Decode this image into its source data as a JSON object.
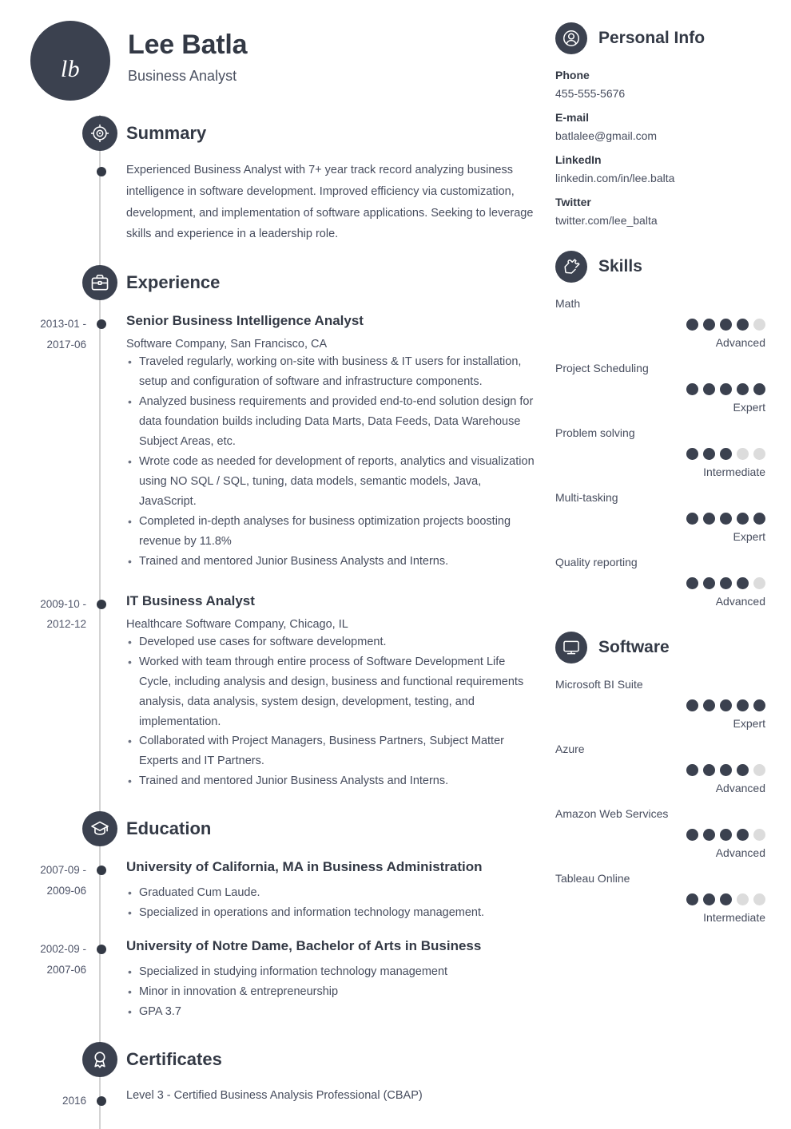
{
  "header": {
    "monogram": "lb",
    "name": "Lee Batla",
    "job_title": "Business Analyst"
  },
  "sections": {
    "summary": {
      "title": "Summary",
      "icon": "target-icon",
      "text": "Experienced Business Analyst with 7+ year track record analyzing business intelligence in software development. Improved efficiency via customization, development, and implementation of software applications. Seeking to leverage skills and experience in a leadership role."
    },
    "experience": {
      "title": "Experience",
      "icon": "briefcase-icon",
      "entries": [
        {
          "date_from": "2013-01 -",
          "date_to": "2017-06",
          "title": "Senior Business Intelligence Analyst",
          "subtitle": " Software Company, San Francisco, CA",
          "points": [
            "Traveled regularly, working on-site with business & IT users for installation, setup and configuration of software and infrastructure components.",
            "Analyzed business requirements and provided end-to-end solution design for data foundation builds including Data Marts, Data Feeds, Data Warehouse Subject Areas, etc.",
            "Wrote code as needed for development of reports, analytics and visualization using NO SQL / SQL, tuning, data models, semantic models, Java, JavaScript.",
            "Completed in-depth analyses for business optimization projects boosting revenue by 11.8%",
            "Trained and mentored Junior Business Analysts and Interns."
          ]
        },
        {
          "date_from": "2009-10 -",
          "date_to": "2012-12",
          "title": "IT Business Analyst",
          "subtitle": "Healthcare Software Company, Chicago, IL",
          "points": [
            "Developed use cases for software development.",
            "Worked with team through entire process of Software Development Life Cycle, including analysis and design, business and functional requirements analysis, data analysis, system design, development, testing, and implementation.",
            "Collaborated with Project Managers, Business Partners, Subject Matter Experts and IT Partners.",
            "Trained and mentored Junior Business Analysts and Interns."
          ]
        }
      ]
    },
    "education": {
      "title": "Education",
      "icon": "graduation-cap-icon",
      "entries": [
        {
          "date_from": "2007-09 -",
          "date_to": "2009-06",
          "title": "University of California, MA in Business Administration",
          "subtitle": "",
          "points": [
            "Graduated Cum Laude.",
            "Specialized in operations and information technology management."
          ]
        },
        {
          "date_from": "2002-09 -",
          "date_to": "2007-06",
          "title": "University of Notre Dame, Bachelor of Arts in Business",
          "subtitle": "",
          "points": [
            "Specialized in studying information technology management",
            "Minor in innovation & entrepreneurship",
            "GPA 3.7"
          ]
        }
      ]
    },
    "certificates": {
      "title": "Certificates",
      "icon": "award-icon",
      "entries": [
        {
          "date_from": "2016",
          "date_to": "",
          "title": "",
          "subtitle": "Level 3 - Certified Business Analysis Professional (CBAP)",
          "points": []
        }
      ]
    }
  },
  "sidebar": {
    "personal_info": {
      "title": "Personal Info",
      "icon": "person-icon",
      "fields": [
        {
          "label": "Phone",
          "value": "455-555-5676"
        },
        {
          "label": "E-mail",
          "value": "batlalee@gmail.com"
        },
        {
          "label": "LinkedIn",
          "value": "linkedin.com/in/lee.balta"
        },
        {
          "label": "Twitter",
          "value": "twitter.com/lee_balta"
        }
      ]
    },
    "skills": {
      "title": "Skills",
      "icon": "puzzle-icon",
      "max_rating": 5,
      "items": [
        {
          "name": "Math",
          "rating": 4,
          "level": "Advanced"
        },
        {
          "name": "Project Scheduling",
          "rating": 5,
          "level": "Expert"
        },
        {
          "name": "Problem solving",
          "rating": 3,
          "level": "Intermediate"
        },
        {
          "name": "Multi-tasking",
          "rating": 5,
          "level": "Expert"
        },
        {
          "name": "Quality reporting",
          "rating": 4,
          "level": "Advanced"
        }
      ]
    },
    "software": {
      "title": "Software",
      "icon": "monitor-icon",
      "max_rating": 5,
      "items": [
        {
          "name": "Microsoft BI Suite",
          "rating": 5,
          "level": "Expert"
        },
        {
          "name": "Azure",
          "rating": 4,
          "level": "Advanced"
        },
        {
          "name": "Amazon Web Services",
          "rating": 4,
          "level": "Advanced"
        },
        {
          "name": "Tableau Online",
          "rating": 3,
          "level": "Intermediate"
        }
      ]
    }
  },
  "colors": {
    "accent_dark": "#3b414f",
    "text_dark": "#333945",
    "text_body": "#474d5e",
    "dot_inactive": "#dcdcdc",
    "timeline_line": "#d3d3d3"
  }
}
